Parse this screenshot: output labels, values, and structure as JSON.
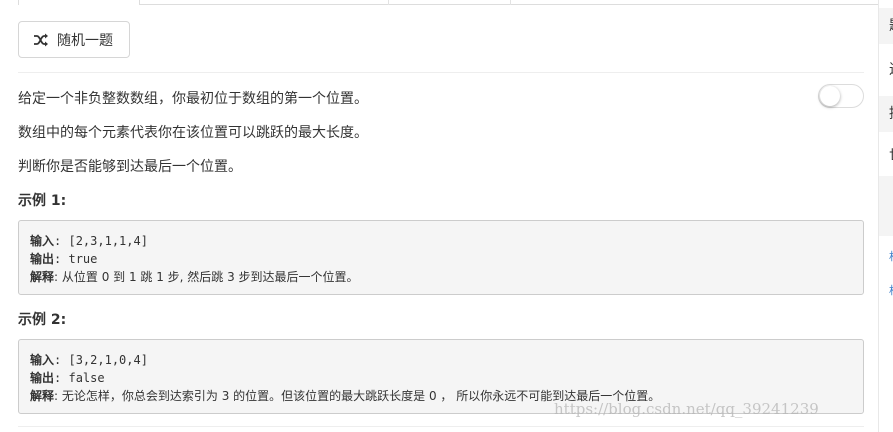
{
  "toolbar": {
    "random_label": "随机一题"
  },
  "problem": {
    "paragraphs": [
      "给定一个非负整数数组，你最初位于数组的第一个位置。",
      "数组中的每个元素代表你在该位置可以跳跃的最大长度。",
      "判断你是否能够到达最后一个位置。"
    ],
    "examples": [
      {
        "title": "示例 1:",
        "input_label": "输入",
        "input_value": ": [2,3,1,1,4]",
        "output_label": "输出",
        "output_value": ": true",
        "explain_label": "解释",
        "explain_value": ": 从位置 0 到 1 跳 1 步, 然后跳 3 步到达最后一个位置。"
      },
      {
        "title": "示例 2:",
        "input_label": "输入",
        "input_value": ": [3,2,1,0,4]",
        "output_label": "输出",
        "output_value": ": false",
        "explain_label": "解释",
        "explain_value": ": 无论怎样，你总会到达索引为 3 的位置。但该位置的最大跳跃长度是 0 ， 所以你永远不可能到达最后一个位置。"
      }
    ]
  },
  "watermark": "https://blog.csdn.net/qq_39241239",
  "side_panel": {
    "items": [
      "题",
      "进",
      "提",
      "世"
    ],
    "links": [
      "相",
      "相"
    ]
  },
  "colors": {
    "link": "#3a7dc8",
    "code_bg": "#f5f5f5",
    "border": "#cccccc"
  },
  "icons": {
    "random": "shuffle-icon"
  }
}
